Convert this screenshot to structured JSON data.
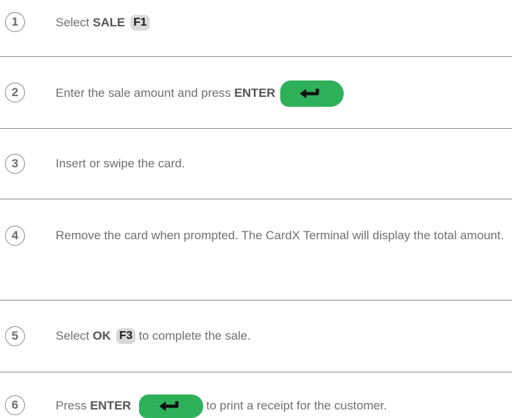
{
  "steps": [
    {
      "number": "1",
      "pre": "Select ",
      "bold": "SALE",
      "key": "F1"
    },
    {
      "number": "2",
      "pre": "Enter the sale amount and press ",
      "bold": "ENTER",
      "key_icon": "enter-key-icon"
    },
    {
      "number": "3",
      "pre": "Insert or swipe the card."
    },
    {
      "number": "4",
      "pre": "Remove the card when prompted. The CardX Terminal will display the total amount."
    },
    {
      "number": "5",
      "pre": "Select ",
      "bold": "OK",
      "key": "F3",
      "post": " to complete the sale."
    },
    {
      "number": "6",
      "pre": "Press ",
      "bold": "ENTER",
      "key_icon": "enter-key-icon",
      "post": " to print a receipt for the customer."
    }
  ],
  "colors": {
    "enter_key": "#2fb05a",
    "function_key": "#d9d9d9",
    "body_text": "#707070",
    "divider": "#8c8c8c"
  }
}
